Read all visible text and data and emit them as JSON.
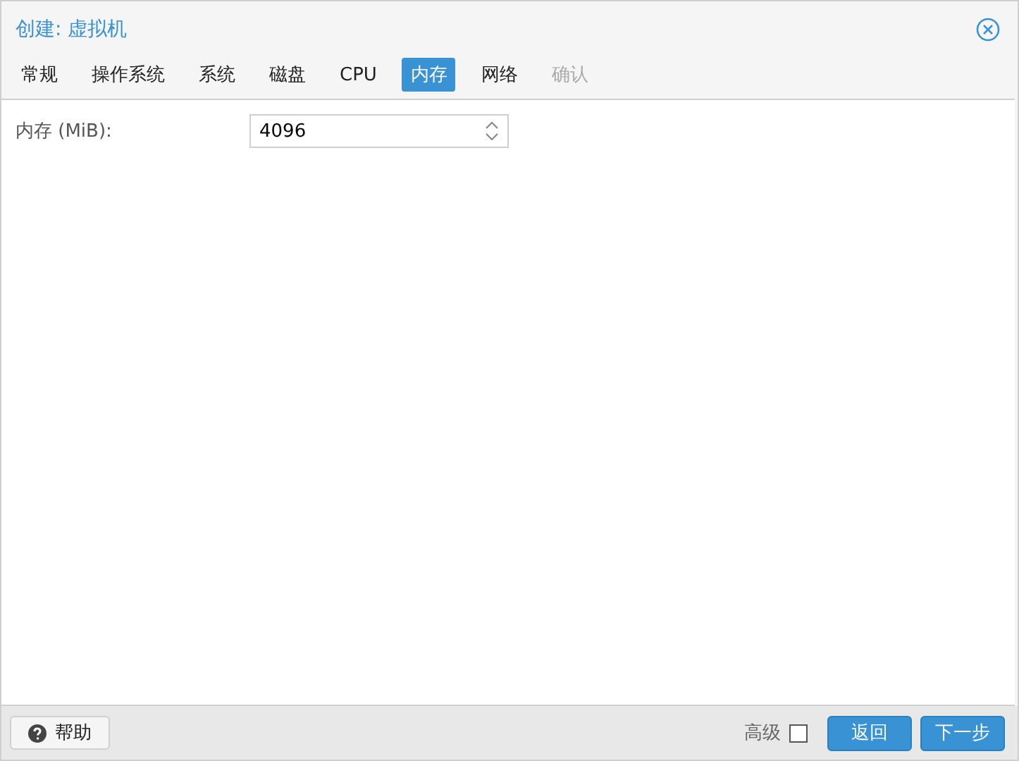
{
  "window": {
    "title": "创建: 虚拟机"
  },
  "tabs": [
    {
      "label": "常规",
      "selected": false,
      "disabled": false
    },
    {
      "label": "操作系统",
      "selected": false,
      "disabled": false
    },
    {
      "label": "系统",
      "selected": false,
      "disabled": false
    },
    {
      "label": "磁盘",
      "selected": false,
      "disabled": false
    },
    {
      "label": "CPU",
      "selected": false,
      "disabled": false
    },
    {
      "label": "内存",
      "selected": true,
      "disabled": false
    },
    {
      "label": "网络",
      "selected": false,
      "disabled": false
    },
    {
      "label": "确认",
      "selected": false,
      "disabled": true
    }
  ],
  "form": {
    "label": "内存 (MiB):",
    "value": "4096"
  },
  "footer": {
    "help_button": "帮助",
    "advanced": {
      "label": "高级",
      "checked": false
    },
    "buttons": [
      "返回",
      "下一步"
    ]
  }
}
